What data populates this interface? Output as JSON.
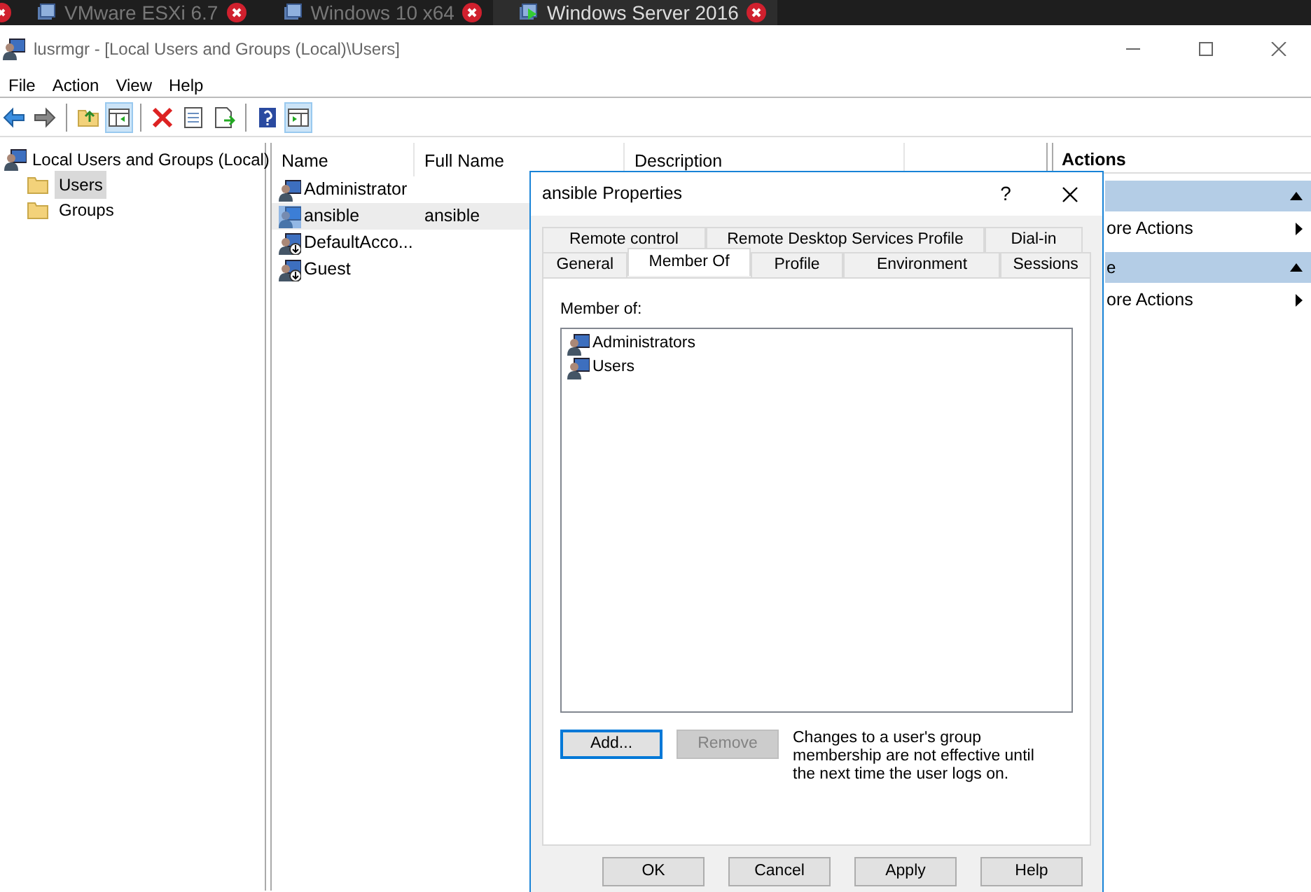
{
  "browser_tabs": [
    {
      "label": "VMware ESXi 6.7",
      "selected": false
    },
    {
      "label": "Windows 10 x64",
      "selected": false
    },
    {
      "label": "Windows Server 2016",
      "selected": true
    }
  ],
  "window": {
    "title": "lusrmgr - [Local Users and Groups (Local)\\Users]"
  },
  "menu": [
    "File",
    "Action",
    "View",
    "Help"
  ],
  "toolbar": [
    {
      "kind": "back",
      "pressed": false
    },
    {
      "kind": "forward",
      "pressed": false
    },
    {
      "kind": "sep"
    },
    {
      "kind": "folder-up",
      "pressed": false
    },
    {
      "kind": "tree",
      "pressed": true
    },
    {
      "kind": "sep"
    },
    {
      "kind": "delete",
      "pressed": false
    },
    {
      "kind": "properties",
      "pressed": false
    },
    {
      "kind": "export",
      "pressed": false
    },
    {
      "kind": "sep"
    },
    {
      "kind": "help",
      "pressed": false
    },
    {
      "kind": "pane",
      "pressed": true
    }
  ],
  "tree": {
    "label": "Local Users and Groups (Local)",
    "children": [
      {
        "label": "Users",
        "selected": true
      },
      {
        "label": "Groups",
        "selected": false
      }
    ]
  },
  "list": {
    "columns": [
      "Name",
      "Full Name",
      "Description"
    ],
    "rows": [
      {
        "name": "Administrator",
        "selected": false,
        "disabled": false
      },
      {
        "name": "ansible",
        "full_name": "ansible",
        "selected": true,
        "disabled": false
      },
      {
        "name": "DefaultAcco...",
        "selected": false,
        "disabled": true
      },
      {
        "name": "Guest",
        "selected": false,
        "disabled": true
      }
    ]
  },
  "actions": {
    "title": "Actions",
    "sections": [
      {
        "items": [
          "ore Actions"
        ]
      },
      {
        "header": "e",
        "items": [
          "ore Actions"
        ]
      }
    ]
  },
  "dialog": {
    "title": "ansible Properties",
    "help": "?",
    "tab_rows": [
      [
        {
          "label": "Remote control",
          "selected": false
        },
        {
          "label": "Remote Desktop Services Profile",
          "selected": false
        },
        {
          "label": "Dial-in",
          "selected": false
        }
      ],
      [
        {
          "label": "General",
          "selected": false
        },
        {
          "label": "Member Of",
          "selected": true
        },
        {
          "label": "Profile",
          "selected": false
        },
        {
          "label": "Environment",
          "selected": false
        },
        {
          "label": "Sessions",
          "selected": false
        }
      ]
    ],
    "member_label": "Member of:",
    "members": [
      "Administrators",
      "Users"
    ],
    "buttons": [
      {
        "label": "Add...",
        "disabled": false,
        "focused": true
      },
      {
        "label": "Remove",
        "disabled": true,
        "focused": false
      }
    ],
    "note": "Changes to a user's group membership are not effective until the next time the user logs on.",
    "footer": [
      "OK",
      "Cancel",
      "Apply",
      "Help"
    ]
  }
}
